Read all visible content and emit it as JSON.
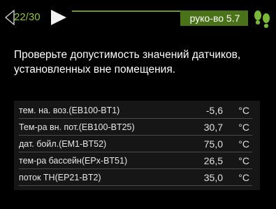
{
  "header": {
    "page_counter": "22/30",
    "manual_label": "руко-во 5.7",
    "prev_icon": "arrow-left-icon",
    "next_icon": "arrow-right-icon",
    "help_icon": "footprints-icon"
  },
  "instruction": {
    "line1": "Проверьте допустимость значений датчиков,",
    "line2": "установленных вне помещения."
  },
  "sensors": [
    {
      "name": "тем. на. воз.(EB100-BT1)",
      "value": "-5,6",
      "unit": "°C"
    },
    {
      "name": "Тем-ра вн. пот.(EB100-BT25)",
      "value": "30,7",
      "unit": "°C"
    },
    {
      "name": "дат. бойл.(EM1-BT52)",
      "value": "75,0",
      "unit": "°C"
    },
    {
      "name": "тем-ра бассейн(EPx-BT51)",
      "value": "26,5",
      "unit": "°C"
    },
    {
      "name": "поток ТН(EP21-BT2)",
      "value": "35,0",
      "unit": "°C"
    }
  ],
  "colors": {
    "background": "#000000",
    "accent_green": "#8fc23a",
    "badge_green": "#4a7218"
  }
}
